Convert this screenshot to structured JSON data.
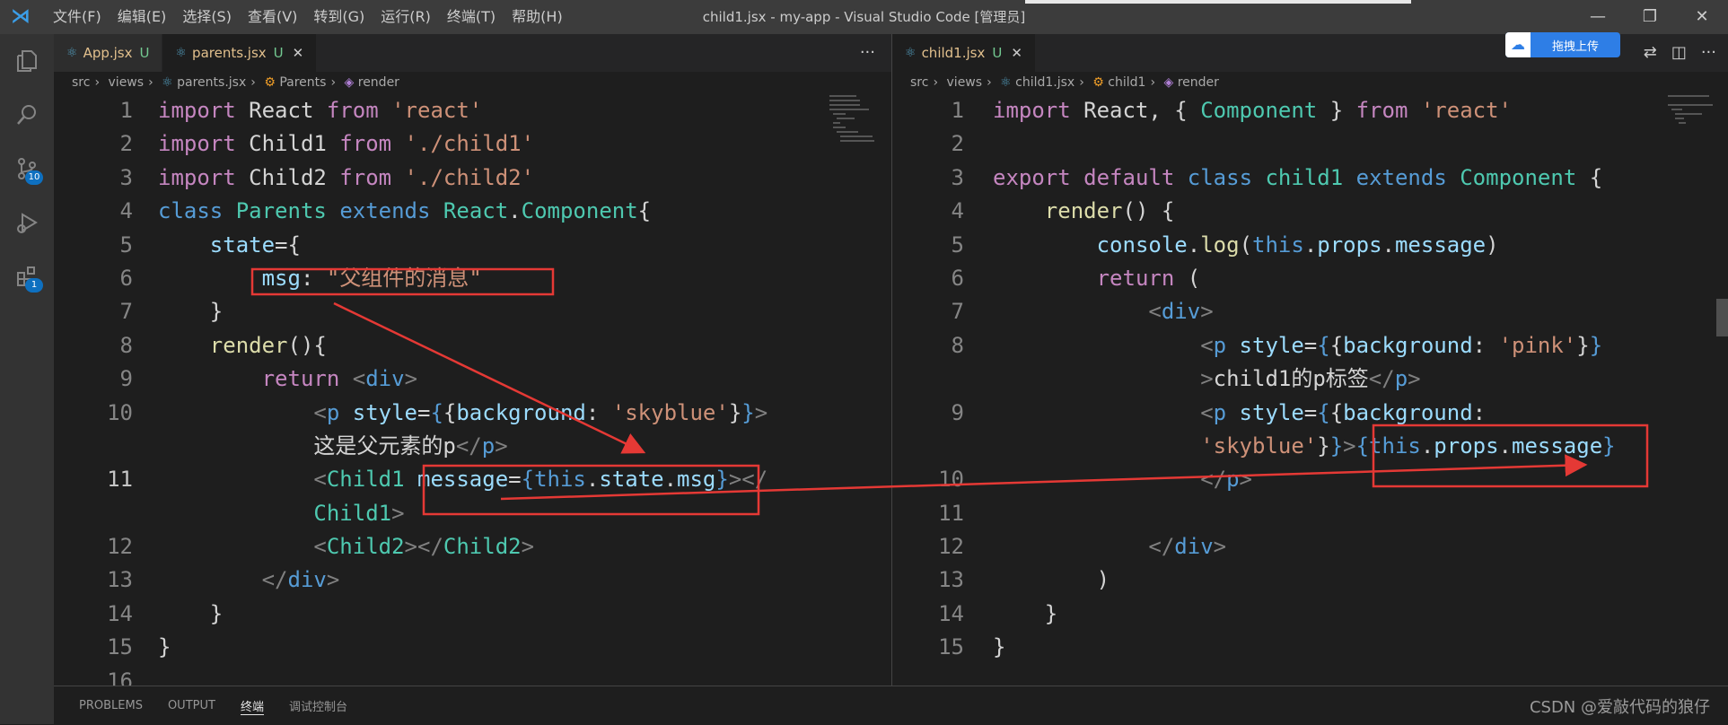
{
  "window": {
    "title": "child1.jsx - my-app - Visual Studio Code [管理员]",
    "menu": [
      "文件(F)",
      "编辑(E)",
      "选择(S)",
      "查看(V)",
      "转到(G)",
      "运行(R)",
      "终端(T)",
      "帮助(H)"
    ],
    "controls": {
      "minimize": "—",
      "restore": "❐",
      "close": "✕"
    }
  },
  "activity_bar": {
    "source_control_badge": "10",
    "extensions_badge": "1"
  },
  "left_editor": {
    "tabs": [
      {
        "name": "App.jsx",
        "status": "U"
      },
      {
        "name": "parents.jsx",
        "status": "U",
        "close": "✕"
      }
    ],
    "more": "···",
    "breadcrumb": [
      "src",
      "views",
      "parents.jsx",
      "Parents",
      "render"
    ],
    "line_numbers": [
      "1",
      "2",
      "3",
      "4",
      "5",
      "6",
      "7",
      "8",
      "9",
      "10",
      "",
      "11",
      "",
      "12",
      "13",
      "14",
      "15",
      "16"
    ]
  },
  "right_editor": {
    "tabs": [
      {
        "name": "child1.jsx",
        "status": "U",
        "close": "✕"
      }
    ],
    "breadcrumb": [
      "src",
      "views",
      "child1.jsx",
      "child1",
      "render"
    ],
    "line_numbers": [
      "1",
      "2",
      "3",
      "4",
      "5",
      "6",
      "7",
      "8",
      "",
      "9",
      "",
      "10",
      "11",
      "12",
      "13",
      "14",
      "15"
    ]
  },
  "upload_button": {
    "label": "拖拽上传"
  },
  "panel": {
    "tabs": [
      "PROBLEMS",
      "OUTPUT",
      "终端",
      "调试控制台"
    ],
    "active_tab": "终端"
  },
  "watermark": "CSDN @爱敲代码的狼仔",
  "colors": {
    "annotation_red": "#e53935",
    "background": "#1e1e1e",
    "keyword": "#569cd6"
  }
}
